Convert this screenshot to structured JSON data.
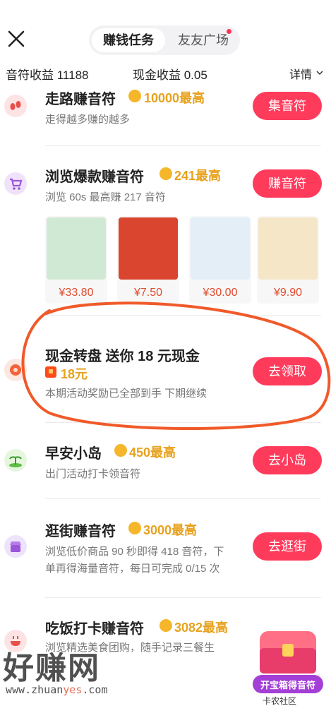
{
  "header": {
    "tab_active": "赚钱任务",
    "tab_other": "友友广场"
  },
  "earnings": {
    "note_label": "音符收益 11188",
    "cash_label": "现金收益 0.05",
    "detail_label": "详情"
  },
  "tasks": [
    {
      "title": "走路赚音符",
      "reward": "10000最高",
      "desc": "走得越多赚的越多",
      "button": "集音符",
      "icon": "footprint-icon"
    },
    {
      "title": "浏览爆款赚音符",
      "reward": "241最高",
      "desc": "浏览 60s 最高赚 217 音符",
      "button": "赚音符",
      "icon": "cart-icon"
    },
    {
      "title": "现金转盘 送你 18 元现金",
      "reward": "18元",
      "desc": "本期活动奖励已全部到手 下期继续",
      "button": "去领取",
      "icon": "wheel-icon"
    },
    {
      "title": "早安小岛",
      "reward": "450最高",
      "desc": "出门活动打卡领音符",
      "button": "去小岛",
      "icon": "island-icon"
    },
    {
      "title": "逛街赚音符",
      "reward": "3000最高",
      "desc": "浏览低价商品 90 秒即得 418 音符，下",
      "desc2": "单再得海量音符，每日可完成 0/15 次",
      "button": "去逛街",
      "icon": "shop-icon"
    },
    {
      "title": "吃饭打卡赚音符",
      "reward": "3082最高",
      "desc": "浏览精选美食团购，随手记录三餐生",
      "icon": "food-icon"
    }
  ],
  "products": [
    {
      "price": "¥33.80",
      "color": "#cfe9d4"
    },
    {
      "price": "¥7.50",
      "color": "#d9452f"
    },
    {
      "price": "¥30.00",
      "color": "#e3eef7"
    },
    {
      "price": "¥9.90",
      "color": "#f6e6c8"
    }
  ],
  "treasure": {
    "label": "开宝箱得音符"
  },
  "watermark": {
    "main": "好赚网",
    "url_a": "www.zhuan",
    "url_b": "yes",
    "url_c": ".com",
    "corner": "卡农社区"
  },
  "colors": {
    "accent": "#ff3b5c",
    "reward": "#e7a21f",
    "annotation": "#f05a2a"
  }
}
